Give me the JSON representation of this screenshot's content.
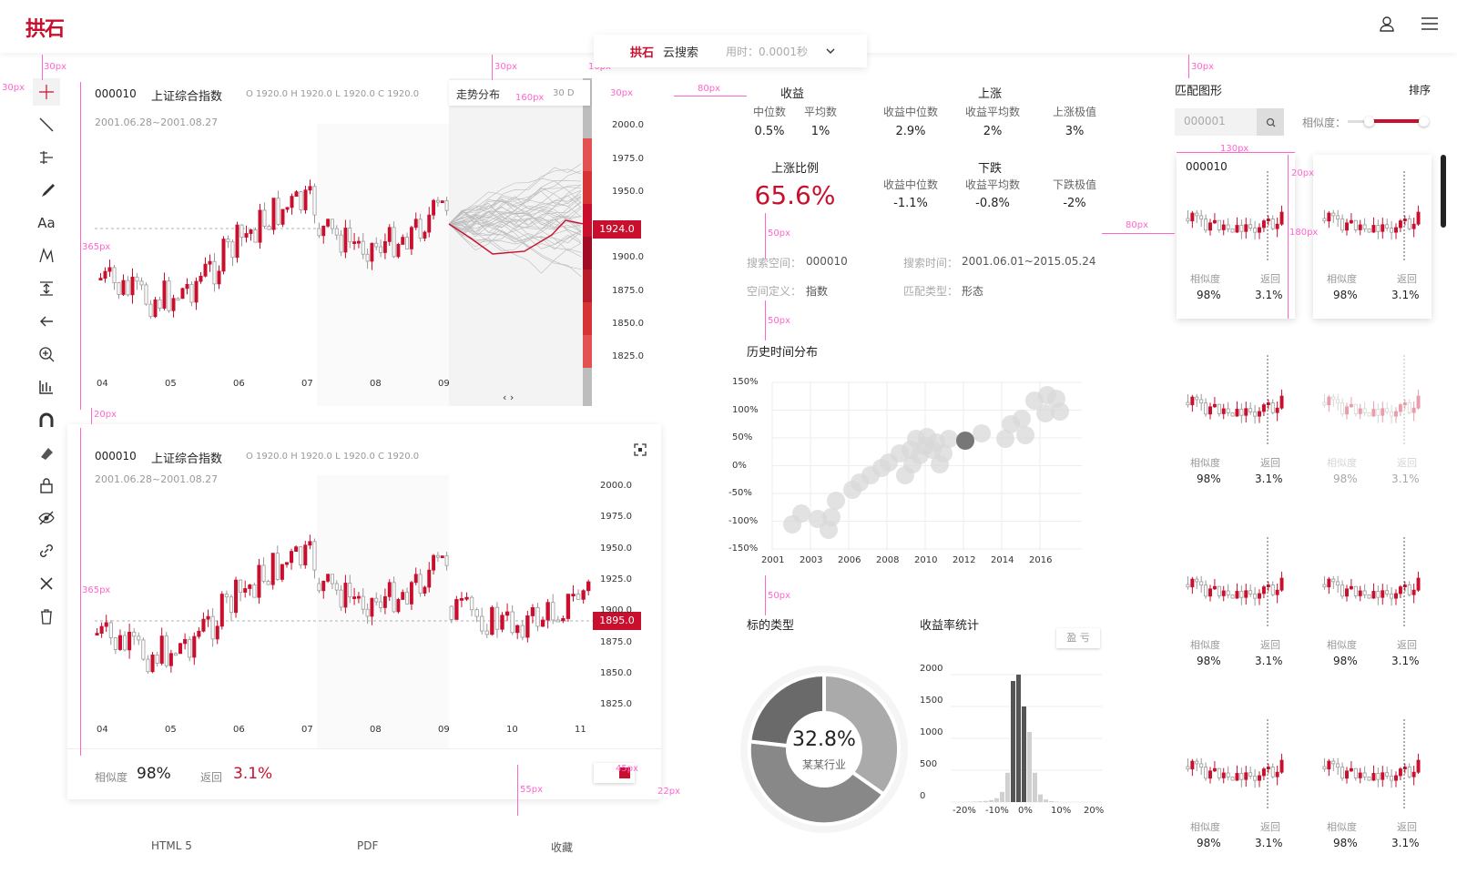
{
  "header": {
    "logo": "拱石",
    "search_brand": "拱石",
    "search_label": "云搜索",
    "search_time": "用时：0.0001秒"
  },
  "chart_top": {
    "code": "000010",
    "name": "上证综合指数",
    "ohlc": "O 1920.0  H 1920.0  L 1920.0  C 1920.0",
    "range": "2001.06.28~2001.08.27",
    "trend_label": "走势分布",
    "trend_days": "30 D",
    "current": "1924.0",
    "y_ticks": [
      "2000.0",
      "1975.0",
      "1950.0",
      "1900.0",
      "1875.0",
      "1850.0",
      "1825.0"
    ],
    "x_ticks": [
      "04",
      "05",
      "06",
      "07",
      "08",
      "09"
    ]
  },
  "chart_bottom": {
    "code": "000010",
    "name": "上证综合指数",
    "ohlc": "O 1920.0  H 1920.0  L 1920.0  C 1920.0",
    "range": "2001.06.28~2001.08.27",
    "current": "1895.0",
    "y_ticks": [
      "2000.0",
      "1975.0",
      "1950.0",
      "1925.0",
      "1900.0",
      "1875.0",
      "1850.0",
      "1825.0"
    ],
    "x_ticks": [
      "04",
      "05",
      "06",
      "07",
      "08",
      "09",
      "10",
      "11"
    ],
    "similarity_label": "相似度",
    "similarity": "98%",
    "return_label": "返回",
    "return": "3.1%"
  },
  "stats": {
    "income_title": "收益",
    "median_label": "中位数",
    "avg_label": "平均数",
    "median": "0.5%",
    "avg": "1%",
    "up_title": "上涨",
    "up_median_label": "收益中位数",
    "up_avg_label": "收益平均数",
    "up_max_label": "上涨极值",
    "up_median": "2.9%",
    "up_avg": "2%",
    "up_max": "3%",
    "ratio_title": "上涨比例",
    "ratio": "65.6%",
    "down_title": "下跌",
    "down_median_label": "收益中位数",
    "down_avg_label": "收益平均数",
    "down_max_label": "下跌极值",
    "down_median": "-1.1%",
    "down_avg": "-0.8%",
    "down_max": "-2%",
    "space_label": "搜索空间：",
    "space": "000010",
    "time_label": "搜索时间：",
    "time": "2001.06.01~2015.05.24",
    "def_label": "空间定义：",
    "def": "指数",
    "type_label": "匹配类型：",
    "type": "形态"
  },
  "history": {
    "title": "历史时间分布",
    "y_ticks": [
      "150%",
      "100%",
      "50%",
      "0%",
      "-50%",
      "-100%",
      "-150%"
    ],
    "x_ticks": [
      "2001",
      "2003",
      "2006",
      "2008",
      "2010",
      "2012",
      "2014",
      "2016"
    ]
  },
  "target_type": {
    "title": "标的类型",
    "pct": "32.8%",
    "sub": "某某行业"
  },
  "returns": {
    "title": "收益率统计",
    "toggle": "盈 亏",
    "y_ticks": [
      "2000",
      "1500",
      "1000",
      "500",
      "0"
    ],
    "x_ticks": [
      "-20%",
      "-10%",
      "0%",
      "10%",
      "20%"
    ]
  },
  "match": {
    "title": "匹配图形",
    "sort": "排序",
    "input_placeholder": "000001",
    "sim_label": "相似度：",
    "first_code": "000010",
    "thumbs": [
      {
        "sim_label": "相似度",
        "sim": "98%",
        "ret_label": "返回",
        "ret": "3.1%"
      },
      {
        "sim_label": "相似度",
        "sim": "98%",
        "ret_label": "返回",
        "ret": "3.1%"
      },
      {
        "sim_label": "相似度",
        "sim": "98%",
        "ret_label": "返回",
        "ret": "3.1%"
      },
      {
        "sim_label": "相似度",
        "sim": "98%",
        "ret_label": "返回",
        "ret": "3.1%"
      },
      {
        "sim_label": "相似度",
        "sim": "98%",
        "ret_label": "返回",
        "ret": "3.1%"
      },
      {
        "sim_label": "相似度",
        "sim": "98%",
        "ret_label": "返回",
        "ret": "3.1%"
      },
      {
        "sim_label": "相似度",
        "sim": "98%",
        "ret_label": "返回",
        "ret": "3.1%"
      },
      {
        "sim_label": "相似度",
        "sim": "98%",
        "ret_label": "返回",
        "ret": "3.1%"
      }
    ]
  },
  "footer": {
    "html5": "HTML 5",
    "pdf": "PDF",
    "fav": "收藏"
  },
  "measures": {
    "m30": "30px",
    "m10": "10px",
    "m160": "160px",
    "m80": "80px",
    "m365": "365px",
    "m20": "20px",
    "m50": "50px",
    "m130": "130px",
    "m180": "180px",
    "m45": "45px",
    "m55": "55px",
    "m22": "22px"
  },
  "colors": {
    "accent": "#c8102e",
    "measure": "#ff66cc"
  }
}
